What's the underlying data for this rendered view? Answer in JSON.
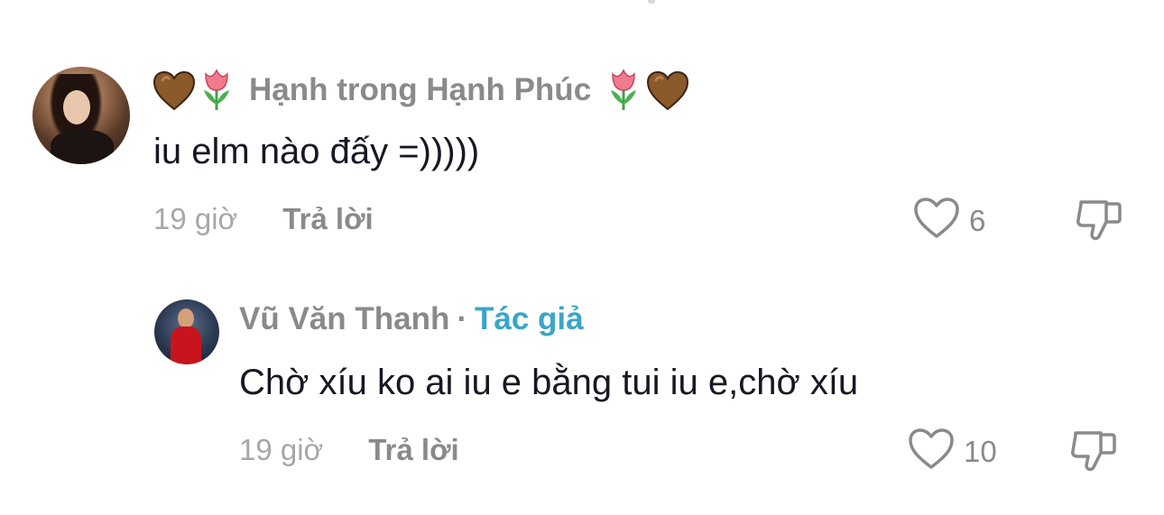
{
  "comments": [
    {
      "author": "Hạnh trong Hạnh Phúc",
      "decor_left": [
        "brown-heart-icon",
        "tulip-icon"
      ],
      "decor_right": [
        "tulip-icon",
        "brown-heart-icon"
      ],
      "text": "iu elm nào đấy =)))))",
      "time": "19 giờ",
      "reply_label": "Trả lời",
      "likes": "6"
    }
  ],
  "replies": [
    {
      "author": "Vũ Văn Thanh",
      "separator": "·",
      "badge": "Tác giả",
      "text": "Chờ xíu ko ai iu e bằng tui iu e,chờ xíu",
      "time": "19 giờ",
      "reply_label": "Trả lời",
      "likes": "10"
    }
  ],
  "colors": {
    "name": "#8a8a8a",
    "text": "#161823",
    "meta": "#a7a7a7",
    "author_badge": "#3aa5c9",
    "brown_heart": "#8b5a2b",
    "tulip": "#f07a8e"
  }
}
